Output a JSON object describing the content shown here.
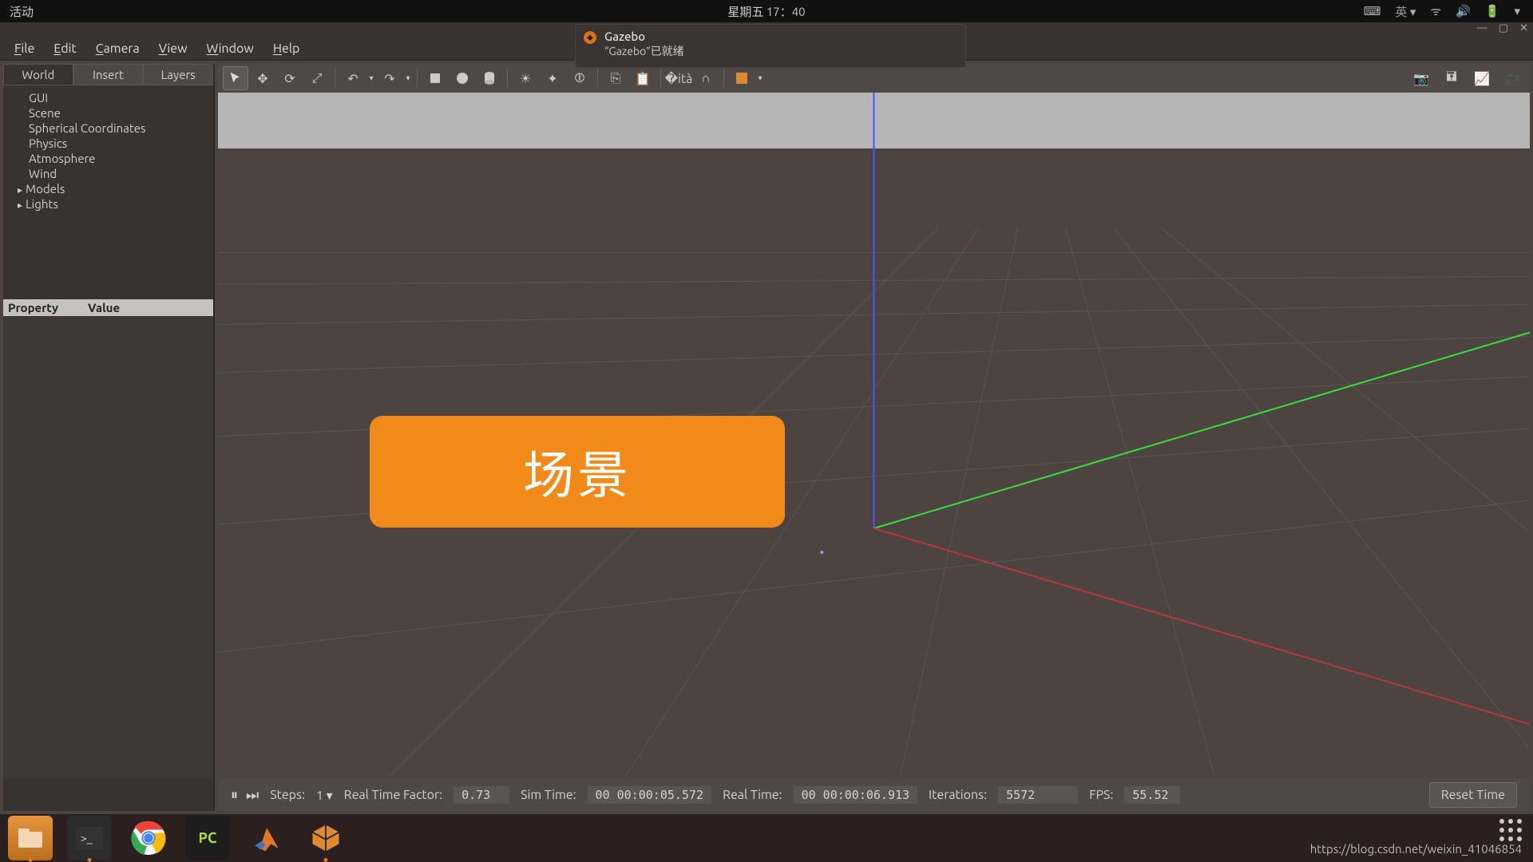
{
  "topbar": {
    "activities": "活动",
    "clock": "星期五 17：40",
    "ime": "英"
  },
  "notification": {
    "title": "Gazebo",
    "subtitle": "“Gazebo”已就绪"
  },
  "menu": {
    "file": "File",
    "edit": "Edit",
    "camera": "Camera",
    "view": "View",
    "window": "Window",
    "help": "Help"
  },
  "panel": {
    "tabs": {
      "world": "World",
      "insert": "Insert",
      "layers": "Layers"
    },
    "tree": {
      "gui": "GUI",
      "scene": "Scene",
      "spherical": "Spherical Coordinates",
      "physics": "Physics",
      "atmosphere": "Atmosphere",
      "wind": "Wind",
      "models": "Models",
      "lights": "Lights"
    },
    "prop_header": {
      "property": "Property",
      "value": "Value"
    }
  },
  "callout": {
    "text": "场景"
  },
  "status": {
    "steps_label": "Steps:",
    "steps_value": "1",
    "rtf_label": "Real Time Factor:",
    "rtf_value": "0.73",
    "simtime_label": "Sim Time:",
    "simtime_value": "00 00:00:05.572",
    "realtime_label": "Real Time:",
    "realtime_value": "00 00:00:06.913",
    "iter_label": "Iterations:",
    "iter_value": "5572",
    "fps_label": "FPS:",
    "fps_value": "55.52",
    "reset": "Reset Time"
  },
  "footer": {
    "url": "https://blog.csdn.net/weixin_41046854"
  }
}
